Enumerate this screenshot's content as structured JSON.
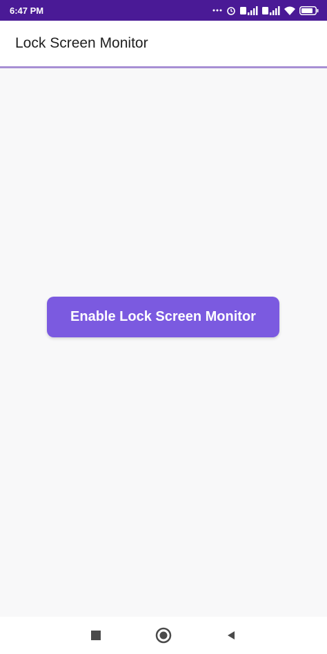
{
  "status_bar": {
    "time": "6:47 PM",
    "icons": [
      "more-dots-icon",
      "alarm-icon",
      "signal-icon",
      "signal-icon",
      "wifi-icon",
      "battery-icon"
    ]
  },
  "app_bar": {
    "title": "Lock Screen Monitor"
  },
  "main": {
    "enable_button_label": "Enable Lock Screen Monitor"
  },
  "nav_bar": {
    "buttons": [
      "recents-button",
      "home-button",
      "back-button"
    ]
  },
  "colors": {
    "status_bar": "#4a1a96",
    "accent": "#7b5ae0",
    "divider": "#a78fd4",
    "background": "#f8f8f9"
  }
}
